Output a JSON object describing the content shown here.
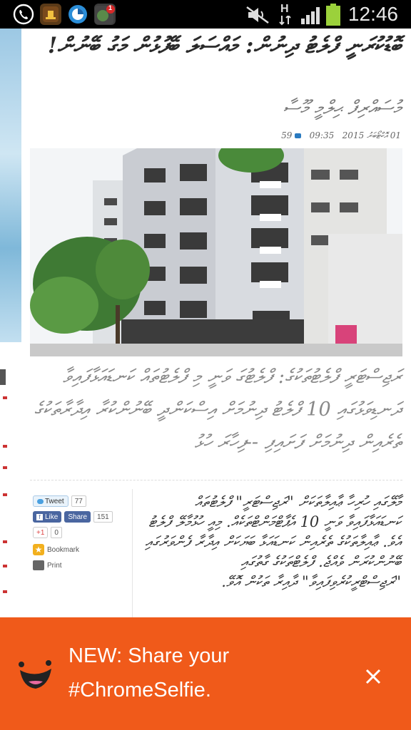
{
  "status_bar": {
    "time": "12:46",
    "icons": [
      "viber-icon",
      "hat-app-icon",
      "blue-round-app-icon",
      "notification-badge-app-icon",
      "mute-icon",
      "h-data-icon",
      "signal-icon",
      "battery-icon"
    ],
    "badge_count": "1",
    "data_type": "H"
  },
  "article": {
    "headline": "ބޮޑުކުރަނީ ފްލެޓު ދިނުން: މައްސަލަ ބޭފުޅުން މަގު ބޭނުން!",
    "author": "މުސައްރިފް ޙިލްމީ މޫސާ",
    "meta": {
      "date": "01 އޮކްޓޯބަރު 2015",
      "time": "09:35",
      "views": "59"
    },
    "summary": "ރަޖިސްޓަރީ ފްލެޓުތަކުގެ: ފްލެޓުގަ ވަނީ މި ފްލެޓުތައް ކަނޑައަޅާފައިވާ ދަނޑިވަޅުގައި 10 ފްލެޓު ދިނުމަށް އިސްކަންދީ ބޭނުންކުރާ އިދާރާތަކުގެ ތެރެއިން ދިނުމަށް ފަށައިފި --ފިހާރަ ހުޅު",
    "body": "މާލޭގައި ހުރިހާ ޢާއިލާތަކަށް \"ރަޖިސްޓަރީ\" ފްލެޓުތައް ކަނޑައަޅާފައިވާ ވަނީ 10 އެޕާޓްމަންޓްތަކެއް. މިއީ ހުޅުމާލޭ ފްލެޓު އެވެ. ޢާއިލާތަކުގެ ތެރެއިން ކަނޑައަޅާ ބަޔަކަށް އިދާރާ ފެންވަރުގައި ބޭނުންކުރަން ވެއްޖެ. ފްލެޓްތަކުގެ ގާތުގައި \"ރަޖިސްޓްރީކުރެވިފައިވާ\" ދާއިރާ ތަކުން އޮވޭ."
  },
  "share": {
    "tweet_label": "Tweet",
    "tweet_count": "77",
    "fb_like_label": "Like",
    "fb_share_label": "Share",
    "fb_count": "151",
    "gplus_label": "+1",
    "gplus_count": "0",
    "bookmark_label": "Bookmark",
    "print_label": "Print"
  },
  "banner": {
    "line1": "NEW: Share your",
    "line2": "#ChromeSelfie.",
    "close_icon": "close-icon",
    "mascot_icon": "smiley-mascot-icon",
    "background_color": "#f05a1a"
  },
  "left_menu_dot_colors": [
    "#cc3333",
    "#cc3333",
    "#cc3333",
    "#cc3333",
    "#cc3333",
    "#cc3333",
    "#cc3333",
    "#cc3333",
    "#cc3333"
  ]
}
